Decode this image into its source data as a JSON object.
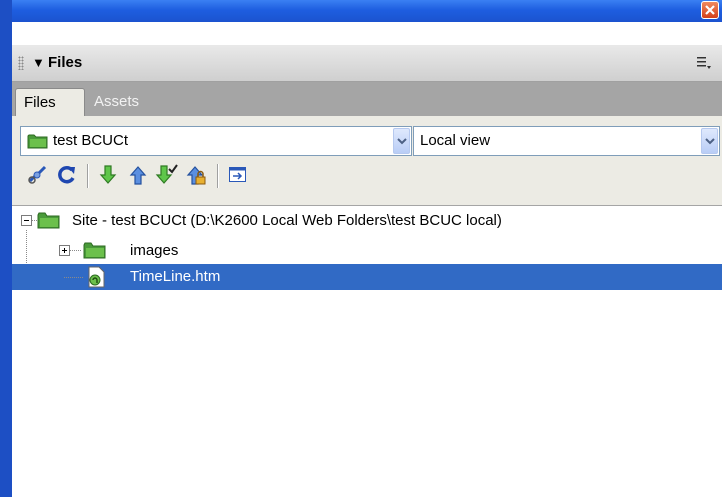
{
  "panel": {
    "title": "Files",
    "tabs": [
      {
        "label": "Files",
        "active": true
      },
      {
        "label": "Assets",
        "active": false
      }
    ]
  },
  "toolbar": {
    "site_select": "test BCUCt",
    "view_select": "Local view",
    "buttons": [
      "connect-icon",
      "refresh-icon",
      "get-files-icon",
      "put-files-icon",
      "check-out-icon",
      "check-in-icon",
      "expand-panel-icon"
    ]
  },
  "tree": {
    "root": "Site - test BCUCt (D:\\K2600 Local Web Folders\\test BCUC local)",
    "items": [
      {
        "label": "images",
        "type": "folder",
        "expanded": false,
        "selected": false
      },
      {
        "label": "TimeLine.htm",
        "type": "file",
        "selected": true
      }
    ]
  },
  "colors": {
    "titlebar": "#1e5ee0",
    "selection": "#316ac5",
    "panel_bg": "#ecebe4",
    "tab_bar": "#a5a5a5"
  }
}
